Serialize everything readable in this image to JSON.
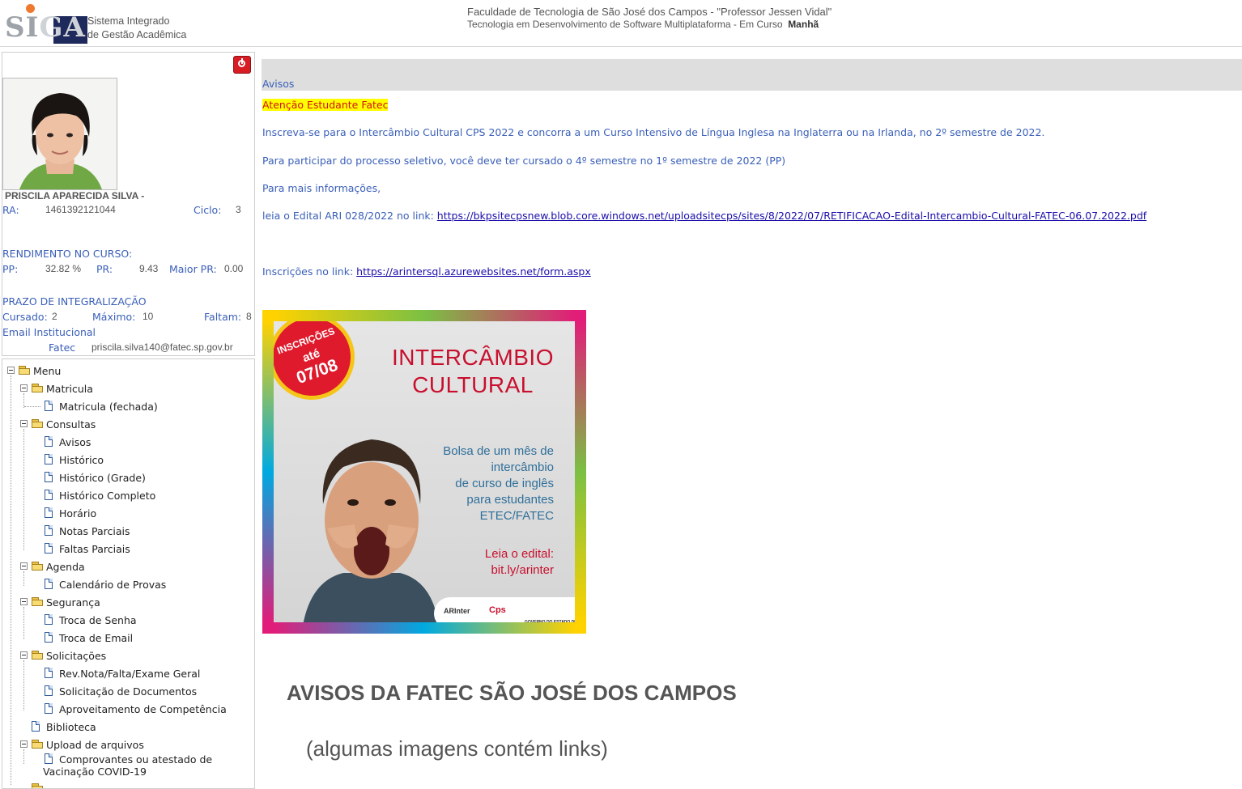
{
  "header": {
    "logo_text_a": "SI",
    "logo_text_b": "GA",
    "system_line1": "Sistema Integrado",
    "system_line2": "de Gestão Acadêmica",
    "school": "Faculdade de Tecnologia de São José dos Campos - \"Professor Jessen Vidal\"",
    "course": "Tecnologia em Desenvolvimento de Software Multiplataforma  -  Em Curso",
    "shift": "Manhã"
  },
  "profile": {
    "name": "PRISCILA APARECIDA SILVA -",
    "ra_label": "RA:",
    "ra_value": "1461392121044",
    "ciclo_label": "Ciclo:",
    "ciclo_value": "3",
    "rendimento_title": "RENDIMENTO NO CURSO:",
    "pp_label": "PP:",
    "pp_value": "32.82 %",
    "pr_label": "PR:",
    "pr_value": "9.43",
    "maior_pr_label": "Maior PR:",
    "maior_pr_value": "0.00",
    "prazo_title": "PRAZO DE INTEGRALIZAÇÃO",
    "cursado_label": "Cursado:",
    "cursado_value": "2",
    "maximo_label": "Máximo:",
    "maximo_value": "10",
    "faltam_label": "Faltam:",
    "faltam_value": "8",
    "email_title": "Email Institucional",
    "email_label": "Fatec",
    "email_value": "priscila.silva140@fatec.sp.gov.br"
  },
  "menu": {
    "root": "Menu",
    "matricula": "Matricula",
    "matricula_fechada": "Matricula (fechada)",
    "consultas": "Consultas",
    "avisos": "Avisos",
    "historico": "Histórico",
    "historico_grade": "Histórico (Grade)",
    "historico_completo": "Histórico Completo",
    "horario": "Horário",
    "notas_parciais": "Notas Parciais",
    "faltas_parciais": "Faltas Parciais",
    "agenda": "Agenda",
    "calendario_provas": "Calendário de Provas",
    "seguranca": "Segurança",
    "troca_senha": "Troca de Senha",
    "troca_email": "Troca de Email",
    "solicitacoes": "Solicitações",
    "rev_nota": "Rev.Nota/Falta/Exame Geral",
    "solicitacao_documentos": "Solicitação de Documentos",
    "aproveitamento": "Aproveitamento de Competência",
    "biblioteca": "Biblioteca",
    "upload": "Upload de arquivos",
    "comprovantes_line1": "Comprovantes ou atestado de",
    "comprovantes_line2": "Vacinação COVID-19"
  },
  "main": {
    "section_title": "Avisos",
    "attention": "Atenção Estudante Fatec",
    "p1": "Inscreva-se para o Intercâmbio Cultural CPS 2022 e concorra a um Curso Intensivo de Língua Inglesa na Inglaterra ou na Irlanda, no 2º semestre de 2022.",
    "p2": "Para participar do processo seletivo, você deve ter cursado o 4º semestre no 1º semestre de 2022 (PP)",
    "p3": "Para mais informações,",
    "p4_prefix": "leia o Edital ARI 028/2022 no link: ",
    "p4_link": "https://bkpsitecpsnew.blob.core.windows.net/uploadsitecps/sites/8/2022/07/RETIFICACAO-Edital-Intercambio-Cultural-FATEC-06.07.2022.pdf",
    "p5_prefix": "Inscrições no link: ",
    "p5_link": "https://arintersql.azurewebsites.net/form.aspx",
    "heading": "AVISOS DA FATEC SÃO JOSÉ DOS CAMPOS",
    "subheading": "(algumas imagens contém links)"
  },
  "poster": {
    "badge_line1": "INSCRIÇÕES",
    "badge_line2": "até",
    "badge_line3": "07/08",
    "title_line1": "INTERCÂMBIO",
    "title_line2": "CULTURAL",
    "desc_line1": "Bolsa de um mês de",
    "desc_line2": "intercâmbio",
    "desc_line3": "de curso de inglês",
    "desc_line4": "para estudantes",
    "desc_line5": "ETEC/FATEC",
    "edital_line1": "Leia o edital:",
    "edital_line2": "bit.ly/arinter",
    "logo1": "ARInter",
    "logo2": "Cps",
    "logo3": "GOVERNO DO ESTADO DE SÃO PAULO"
  },
  "colors": {
    "link_blue": "#3a5fb8",
    "attention_bg": "#ffff00",
    "attention_text": "#d01414",
    "bar_gray": "#dedede"
  }
}
